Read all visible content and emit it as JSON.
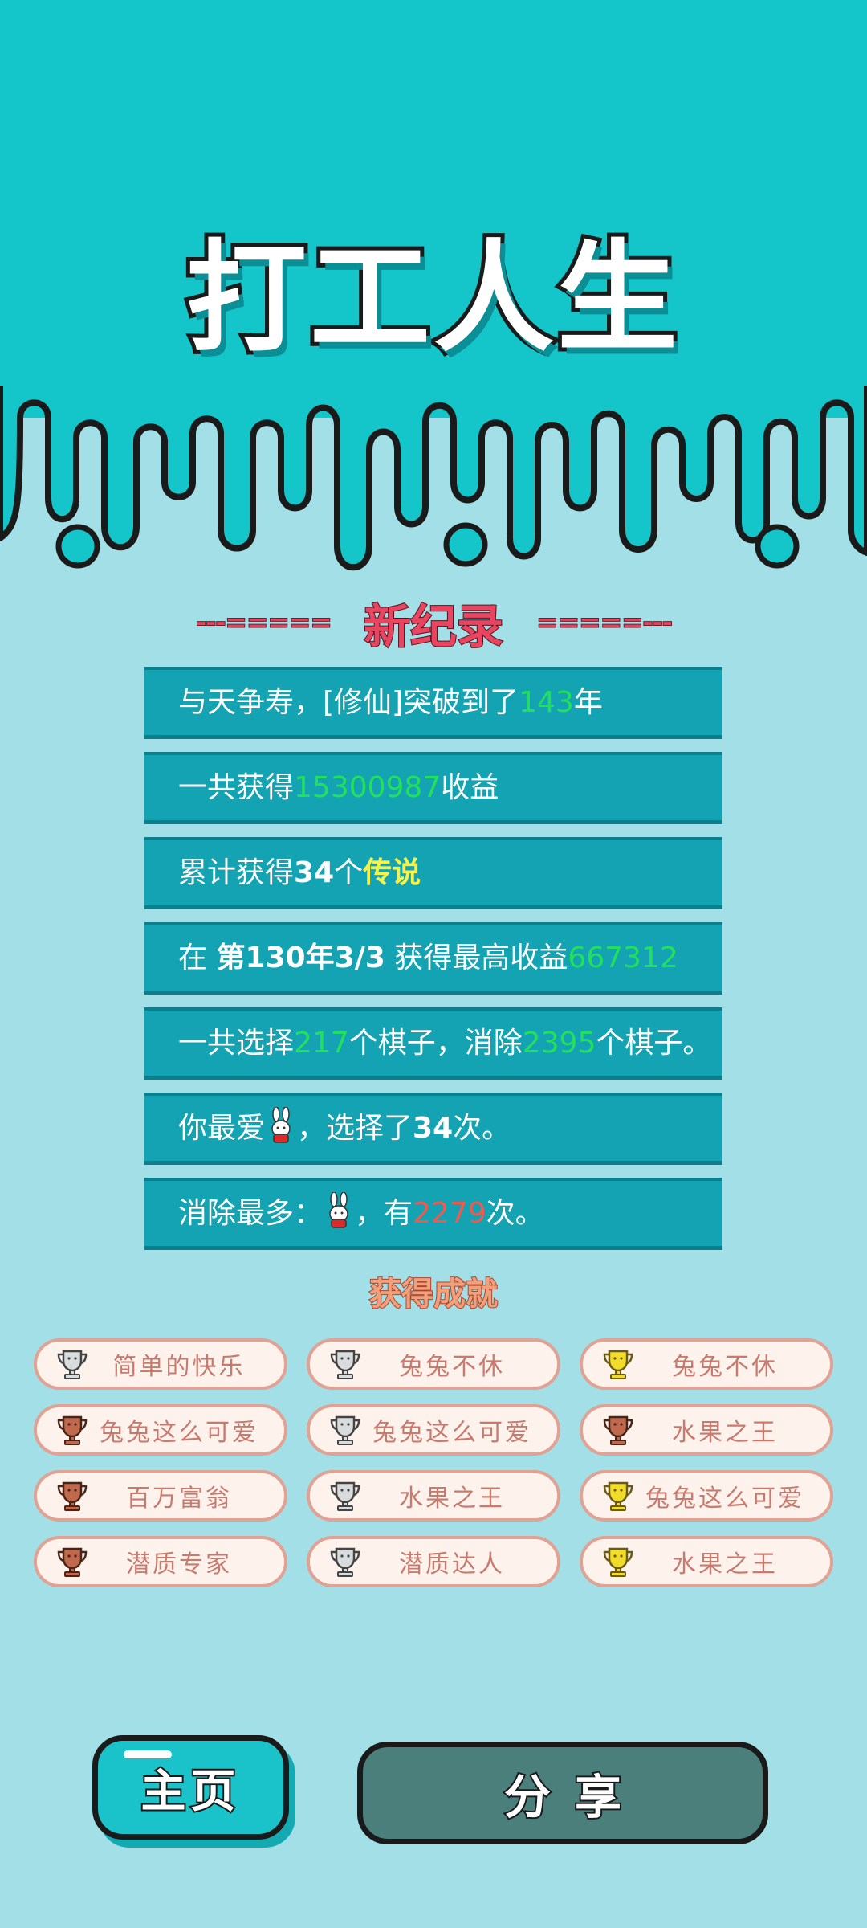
{
  "title": "打工人生",
  "colors": {
    "teal_top": "#14c6c9",
    "background": "#a3dfe6",
    "record_bar": "#13a3b2",
    "highlight_green": "#22e05c",
    "highlight_yellow": "#f6f24c",
    "highlight_red": "#f05a4e",
    "title_red": "#e84560"
  },
  "new_record": {
    "deco_left": "---=====",
    "label": "新纪录",
    "deco_right": "=====---"
  },
  "records": [
    {
      "a": "与天争寿，[修仙]突破到了",
      "value": "143",
      "b": "年"
    },
    {
      "a": "一共获得",
      "value": "15300987",
      "b": "收益"
    },
    {
      "a": "累计获得",
      "bold": "34",
      "c": "个",
      "legend": "传说"
    },
    {
      "a": "在 ",
      "bold": "第130年3/3",
      "c": " 获得最高收益",
      "value": "667312"
    },
    {
      "a": "一共选择",
      "value": "217",
      "b": "个棋子，消除",
      "value2": "2395",
      "c": "个棋子。"
    },
    {
      "a": "你最爱",
      "icon": "bunny-icon",
      "b": "，选择了",
      "bold": "34",
      "c": "次。"
    },
    {
      "a": "消除最多：",
      "icon": "bunny-icon",
      "b": "，有",
      "value": "2279",
      "c": "次。"
    }
  ],
  "achievements_title": "获得成就",
  "achievements": [
    {
      "label": "简单的快乐",
      "tier": "silver"
    },
    {
      "label": "兔兔不休",
      "tier": "silver"
    },
    {
      "label": "兔兔不休",
      "tier": "gold"
    },
    {
      "label": "兔兔这么可爱",
      "tier": "bronze"
    },
    {
      "label": "兔兔这么可爱",
      "tier": "silver"
    },
    {
      "label": "水果之王",
      "tier": "bronze"
    },
    {
      "label": "百万富翁",
      "tier": "bronze"
    },
    {
      "label": "水果之王",
      "tier": "silver"
    },
    {
      "label": "兔兔这么可爱",
      "tier": "gold"
    },
    {
      "label": "潜质专家",
      "tier": "bronze"
    },
    {
      "label": "潜质达人",
      "tier": "silver"
    },
    {
      "label": "水果之王",
      "tier": "gold"
    }
  ],
  "buttons": {
    "home": "主页",
    "share": "分享"
  }
}
